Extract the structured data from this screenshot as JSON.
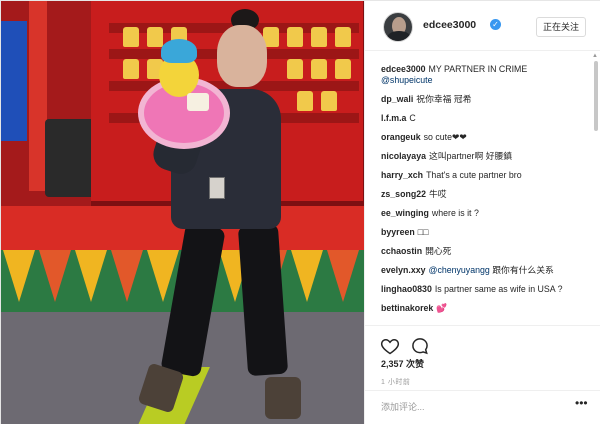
{
  "post": {
    "username": "edcee3000",
    "verified_icon": "verified-badge-icon",
    "follow_label": "正在关注",
    "caption": {
      "user": "edcee3000",
      "text": "MY PARTNER IN CRIME",
      "mention": "@shupeicute"
    },
    "comments": [
      {
        "user": "dp_wali",
        "text": "祝你幸福 冠希"
      },
      {
        "user": "l.f.m.a",
        "text": "C"
      },
      {
        "user": "orangeuk",
        "text": "so cute❤❤"
      },
      {
        "user": "nicolayaya",
        "text": "这叫partner啊 好腰鎮"
      },
      {
        "user": "harry_xch",
        "text": "That's a cute partner bro"
      },
      {
        "user": "zs_song22",
        "text": "牛哎"
      },
      {
        "user": "ee_winging",
        "text": "where is it ?"
      },
      {
        "user": "byyreen",
        "text": "□□"
      },
      {
        "user": "cchaostin",
        "text": "開心死"
      },
      {
        "user": "evelyn.xxy",
        "mention": "@chenyuyangg",
        "text": "跟你有什么关系"
      },
      {
        "user": "linghao0830",
        "text": "Is partner same as wife in USA ?"
      },
      {
        "user": "bettinakorek",
        "text": "💕"
      }
    ],
    "likes": "2,357 次赞",
    "time": "1 小时前",
    "add_comment_placeholder": "添加评论...",
    "more_label": "•••",
    "icons": {
      "like": "heart-icon",
      "comment": "comment-icon"
    },
    "colors": {
      "link": "#003569",
      "verified": "#3897f0",
      "meta": "#999999"
    }
  }
}
